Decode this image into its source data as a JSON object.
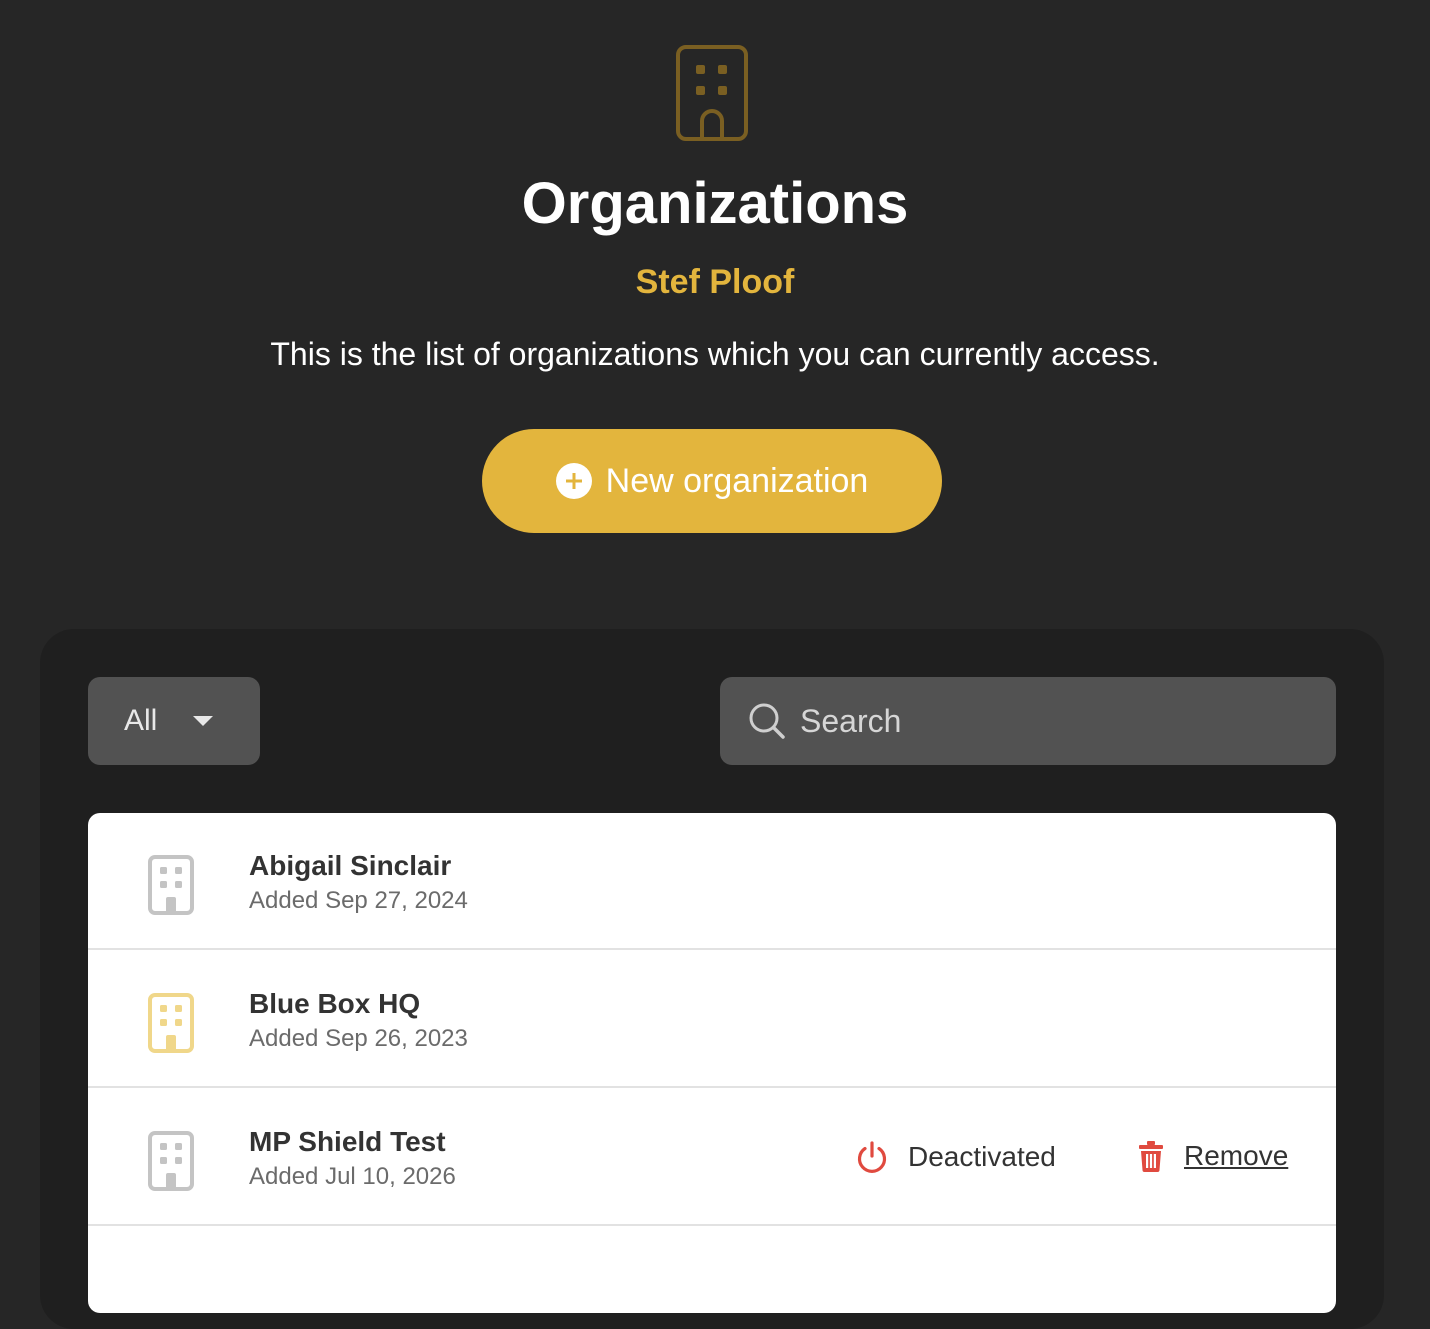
{
  "header": {
    "icon": "building-icon",
    "title": "Organizations",
    "subtitle": "Stef Ploof",
    "description": "This is the list of organizations which you can currently access."
  },
  "actions": {
    "new_org_label": "New organization",
    "new_org_icon": "plus-circle-icon"
  },
  "filters": {
    "selected": "All",
    "search_placeholder": "Search"
  },
  "organizations": [
    {
      "name": "Abigail Sinclair",
      "added": "Added Sep 27, 2024",
      "icon_color": "#c4c4c4"
    },
    {
      "name": "Blue Box HQ",
      "added": "Added Sep 26, 2023",
      "icon_color": "#f0d78a"
    },
    {
      "name": "MP Shield Test",
      "added": "Added Jul 10, 2026",
      "icon_color": "#c4c4c4",
      "status": "Deactivated",
      "remove_label": "Remove"
    }
  ],
  "colors": {
    "accent": "#e3b53d",
    "background": "#262626",
    "danger": "#e04a3f"
  }
}
